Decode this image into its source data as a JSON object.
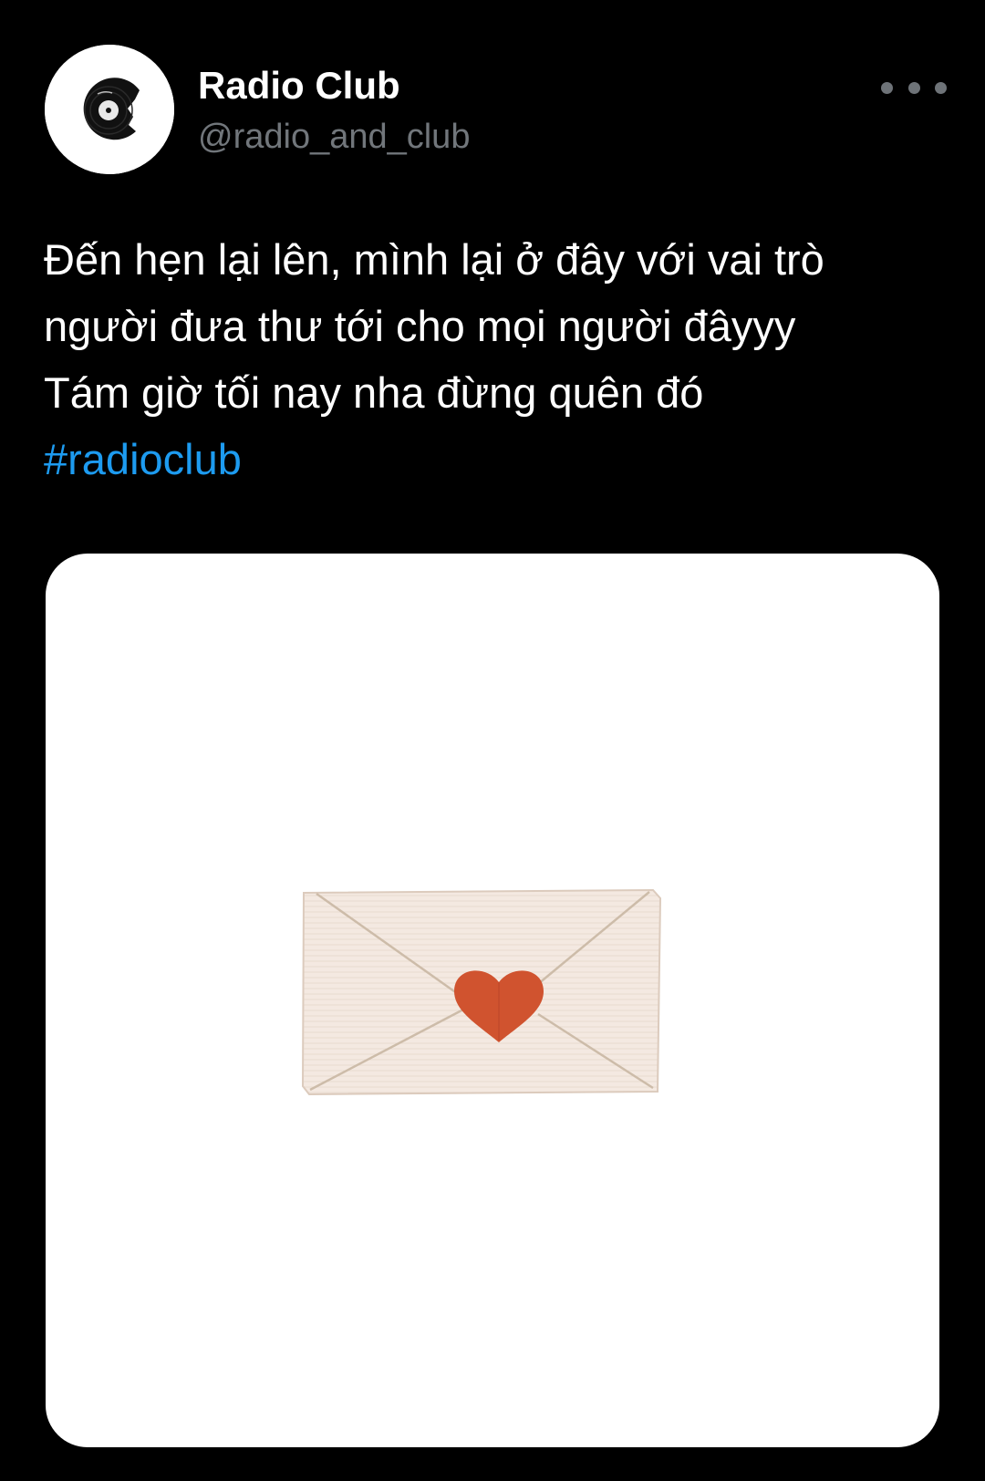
{
  "author": {
    "display_name": "Radio Club",
    "handle": "@radio_and_club",
    "avatar_icon": "vinyl-record-icon"
  },
  "more_button": {
    "icon": "more-horizontal-icon"
  },
  "tweet": {
    "lines": [
      "Đến hẹn lại lên, mình lại ở đây với vai trò",
      "người đưa thư tới cho mọi người đâyyy",
      "Tám giờ tối nay nha đừng quên đó"
    ],
    "hashtag": "#radioclub"
  },
  "media": {
    "icon": "envelope-heart-icon"
  },
  "colors": {
    "background": "#000000",
    "text": "#ffffff",
    "secondary_text": "#71767b",
    "link": "#1d9bf0",
    "heart": "#d0532f",
    "envelope": "#f4e9e1"
  }
}
